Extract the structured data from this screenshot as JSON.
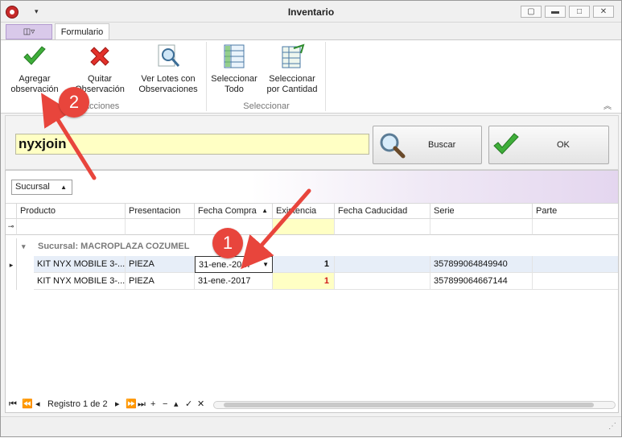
{
  "window": {
    "title": "Inventario",
    "qat_arrow": "▾",
    "btn_restore": "▢",
    "btn_minimize": "▬",
    "btn_maximize": "□",
    "btn_close": "✕"
  },
  "ribbon": {
    "app_menu_label": "◫▿",
    "tab_label": "Formulario",
    "buttons": [
      {
        "label_line1": "Agregar",
        "label_line2": "observación",
        "icon": "check-icon"
      },
      {
        "label_line1": "Quitar",
        "label_line2": "Observación",
        "icon": "x-icon"
      },
      {
        "label_line1": "Ver Lotes con",
        "label_line2": "Observaciones",
        "icon": "magnifier-icon"
      },
      {
        "label_line1": "Seleccionar",
        "label_line2": "Todo",
        "icon": "select-all-icon"
      },
      {
        "label_line1": "Seleccionar",
        "label_line2": "por Cantidad",
        "icon": "select-quantity-icon"
      }
    ],
    "groups": [
      "Acciones",
      "Seleccionar"
    ],
    "collapse_glyph": "︽"
  },
  "search": {
    "value": "nyxjoin",
    "buscar_label": "Buscar",
    "ok_label": "OK"
  },
  "grid": {
    "group_chip": "Sucursal",
    "group_chip_sort": "▲",
    "columns": [
      "Producto",
      "Presentacion",
      "Fecha Compra",
      "Existencia",
      "Fecha Caducidad",
      "Serie",
      "Parte"
    ],
    "sort_indicator": "▲",
    "filter_icon": "⊸",
    "group_row": "Sucursal: MACROPLAZA COZUMEL",
    "group_expand": "▾",
    "row_indicator": "▸",
    "dropdown_glyph": "▼",
    "rows": [
      {
        "producto": "KIT NYX MOBILE 3-...",
        "presentacion": "PIEZA",
        "fecha_compra": "31-ene.-2017",
        "existencia": "1",
        "fecha_caducidad": "",
        "serie": "357899064849940",
        "parte": ""
      },
      {
        "producto": "KIT NYX MOBILE 3-...",
        "presentacion": "PIEZA",
        "fecha_compra": "31-ene.-2017",
        "existencia": "1",
        "fecha_caducidad": "",
        "serie": "357899064667144",
        "parte": ""
      }
    ],
    "navigator": {
      "first": "⏮",
      "prev_page": "⏪",
      "prev": "◂",
      "record_text": "Registro 1 de 2",
      "next": "▸",
      "next_page": "⏩",
      "last": "⏭",
      "add": "+",
      "remove": "−",
      "up": "▴",
      "check": "✓",
      "cancel": "✕",
      "scroll_left": "◂",
      "scroll_right": "▸"
    }
  },
  "status": {
    "grip": "⋰"
  },
  "annotations": {
    "badge1": "1",
    "badge2": "2",
    "color": "#e8453c"
  }
}
